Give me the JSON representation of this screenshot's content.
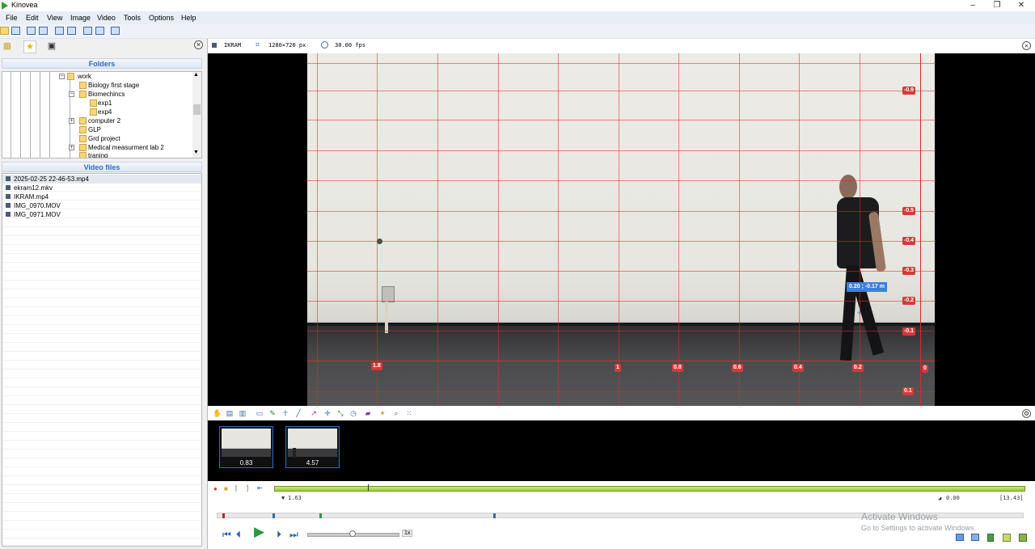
{
  "app": {
    "title": "Kinovea"
  },
  "menu": [
    "File",
    "Edit",
    "View",
    "Image",
    "Video",
    "Tools",
    "Options",
    "Help"
  ],
  "folders": {
    "heading": "Folders",
    "items": [
      {
        "label": "work",
        "level": 0
      },
      {
        "label": "Biology first stage",
        "level": 1
      },
      {
        "label": "Biomechincs",
        "level": 1
      },
      {
        "label": "exp1",
        "level": 2
      },
      {
        "label": "exp4",
        "level": 2
      },
      {
        "label": "computer 2",
        "level": 1
      },
      {
        "label": "GLP",
        "level": 1
      },
      {
        "label": "Grd project",
        "level": 1
      },
      {
        "label": "Medical measurment lab 2",
        "level": 1
      },
      {
        "label": "traning",
        "level": 1
      }
    ]
  },
  "video_files": {
    "heading": "Video files",
    "items": [
      "2025-02-25 22-46-53.mp4",
      "ekram12.mkv",
      "IKRAM.mp4",
      "IMG_0970.MOV",
      "IMG_0971.MOV"
    ]
  },
  "player": {
    "filename": "IKRAM",
    "resolution": "1280×720 px",
    "fps": "30.00 fps"
  },
  "grid": {
    "x_labels": [
      "1.8",
      "1",
      "0.8",
      "0.6",
      "0.4",
      "0.2",
      "0"
    ],
    "y_labels": [
      "-0.9",
      "-0.5",
      "-0.4",
      "-0.3",
      "-0.2",
      "-0.1",
      "0.1"
    ],
    "coordinate": "0.20 ; -0.17 m"
  },
  "thumbnails": [
    "0.83",
    "4.57"
  ],
  "timeline": {
    "start_marker": "1.63",
    "end_marker": "0.00",
    "total": "[13.43]",
    "speed": "1x"
  },
  "watermark": {
    "line1": "Activate Windows",
    "line2": "Go to Settings to activate Windows."
  },
  "colors": {
    "accent": "#2b6cc4",
    "grid": "#d43a3a",
    "track": "#9dcc3a"
  }
}
